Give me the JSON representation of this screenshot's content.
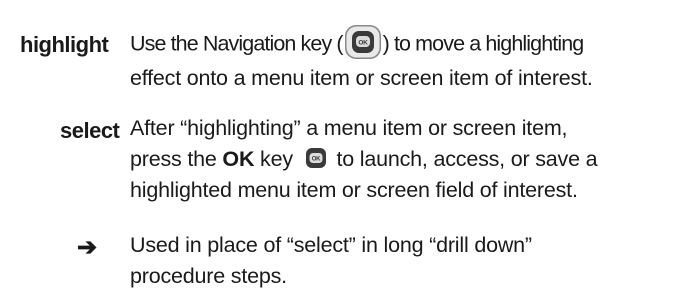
{
  "definitions": [
    {
      "term": "highlight",
      "line1_before": "Use the Navigation key (",
      "line1_after": ") to move a highlighting",
      "line2": "effect onto a menu item or screen item of interest.",
      "icon": "navigation-key-icon"
    },
    {
      "term": "select",
      "line1": "After “highlighting” a menu item or screen item,",
      "line2_before": "press the ",
      "line2_key": "OK",
      "line2_mid": " key ",
      "line2_after": " to launch, access, or save a",
      "line3": "highlighted menu item or screen field of interest.",
      "icon": "ok-key-icon"
    },
    {
      "term": "➔",
      "line1": "Used in place of “select” in long “drill down”",
      "line2": "procedure steps."
    }
  ],
  "colors": {
    "text": "#1a1a1a",
    "key_dark": "#3a3a3a",
    "key_light": "#f2f2f2"
  }
}
